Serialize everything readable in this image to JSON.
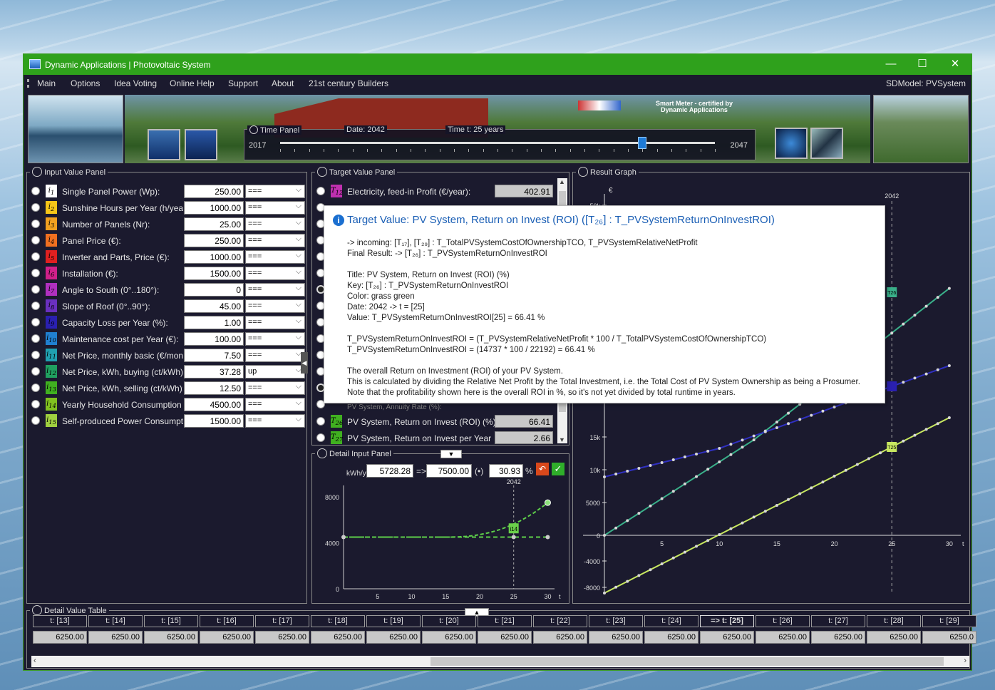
{
  "window": {
    "title": "Dynamic Applications | Photovoltaic System",
    "minimize": "—",
    "maximize": "☐",
    "close": "✕"
  },
  "menu": {
    "items": [
      "Main",
      "Options",
      "Idea Voting",
      "Online Help",
      "Support",
      "About",
      "21st century Builders"
    ],
    "model": "SDModel:  PVSystem"
  },
  "banner": {
    "cert_line1": "Smart Meter - certified by",
    "cert_line2": "Dynamic Applications"
  },
  "time_panel": {
    "label": "Time Panel",
    "date": "Date:  2042",
    "time": "Time t:  25  years",
    "start": "2017",
    "end": "2047",
    "slider_fraction": 0.833
  },
  "input_panel": {
    "title": "Input Value Panel",
    "rows": [
      {
        "sub": "1",
        "color": "#ffffff",
        "label": "Single Panel Power (Wp):",
        "value": "250.00",
        "mode": "==="
      },
      {
        "sub": "2",
        "color": "#f5c518",
        "label": "Sunshine Hours per Year (h/year):",
        "value": "1000.00",
        "mode": "==="
      },
      {
        "sub": "3",
        "color": "#f0a020",
        "label": "Number of Panels (Nr):",
        "value": "25.00",
        "mode": "==="
      },
      {
        "sub": "4",
        "color": "#f07020",
        "label": "Panel Price (€):",
        "value": "250.00",
        "mode": "==="
      },
      {
        "sub": "5",
        "color": "#e02020",
        "label": "Inverter and Parts, Price (€):",
        "value": "1000.00",
        "mode": "==="
      },
      {
        "sub": "6",
        "color": "#d0208a",
        "label": "Installation (€):",
        "value": "1500.00",
        "mode": "==="
      },
      {
        "sub": "7",
        "color": "#b030c0",
        "label": "Angle to South (0°..180°):",
        "value": "0",
        "mode": "==="
      },
      {
        "sub": "8",
        "color": "#6a30c0",
        "label": "Slope of Roof (0°..90°):",
        "value": "45.00",
        "mode": "==="
      },
      {
        "sub": "9",
        "color": "#2a20b0",
        "label": "Capacity Loss per Year (%):",
        "value": "1.00",
        "mode": "==="
      },
      {
        "sub": "10",
        "color": "#2080d0",
        "label": "Maintenance cost per Year (€):",
        "value": "100.00",
        "mode": "==="
      },
      {
        "sub": "11",
        "color": "#20a0b0",
        "label": "Net Price, monthly basic (€/month):",
        "value": "7.50",
        "mode": "==="
      },
      {
        "sub": "12",
        "color": "#20a060",
        "label": "Net Price, kWh, buying (ct/kWh):",
        "value": "37.28",
        "mode": "up"
      },
      {
        "sub": "13",
        "color": "#40b020",
        "label": "Net Price, kWh, selling (ct/kWh):",
        "value": "12.50",
        "mode": "==="
      },
      {
        "sub": "14",
        "color": "#80c020",
        "label": "Yearly Household Consumption (kW",
        "value": "4500.00",
        "mode": "==="
      },
      {
        "sub": "15",
        "color": "#a0d040",
        "label": "Self-produced Power Consumption (",
        "value": "1500.00",
        "mode": "==="
      }
    ]
  },
  "target_panel": {
    "title": "Target Value Panel",
    "top_row": {
      "sub": "12",
      "color": "#c030b0",
      "label": "Electricity, feed-in Profit (€/year):",
      "value": "402.91"
    },
    "partial_row": {
      "label": "PV System, Annuity Rate (%):"
    },
    "bottom_rows": [
      {
        "sub": "26",
        "color": "#40b020",
        "label": "PV System, Return on Invest (ROI) (%):",
        "value": "66.41"
      },
      {
        "sub": "27",
        "color": "#40b020",
        "label": "PV System, Return on Invest per Year (%/ye",
        "value": "2.66"
      }
    ]
  },
  "tooltip": {
    "heading": "Target Value:  PV System, Return on Invest (ROI)  ([T₂₆] : T_PVSystemReturnOnInvestROI)",
    "incoming": "-> incoming:   [T₁₇], [T₂₉] :  T_TotalPVSystemCostOfOwnershipTCO,  T_PVSystemRelativeNetProfit",
    "final_result": "Final Result:  -> [T₂₆] : T_PVSystemReturnOnInvestROI",
    "title_line": "Title:         PV System, Return on Invest (ROI) (%)",
    "key_line": "Key:           [T₂₆] : T_PVSystemReturnOnInvestROI",
    "color_line": "Color:         grass green",
    "date_line": "Date:          2042  ->  t = [25]",
    "value_line": "Value:         T_PVSystemReturnOnInvestROI[25] = 66.41 %",
    "formula1": "T_PVSystemReturnOnInvestROI  =  (T_PVSystemRelativeNetProfit * 100 / T_TotalPVSystemCostOfOwnershipTCO)",
    "formula2": "T_PVSystemReturnOnInvestROI  =  (14737 * 100 / 22192)  =  66.41  %",
    "desc1": "The overall Return on Investment (ROI) of your PV System.",
    "desc2": "This is calculated by dividing the Relative Net Profit by the Total Investment, i.e. the Total Cost of PV System Ownership as being a Prosumer.",
    "desc3": "Note that the profitability shown here is the overall ROI in %, so it's not yet divided by total runtime in years."
  },
  "detail_input": {
    "title": "Detail Input Panel",
    "unit": "kWh/y",
    "from_value": "5728.28",
    "arrow": "=>",
    "to_value": "7500.00",
    "radio": "(•)",
    "percent": "30.93",
    "percent_sign": "%",
    "marker_year": "2042",
    "marker_label": "i14",
    "yticks": [
      "8000",
      "4000",
      "0"
    ],
    "xticks": [
      "5",
      "10",
      "15",
      "20",
      "25",
      "30",
      "t"
    ]
  },
  "result_graph": {
    "title": "Result Graph",
    "y_unit": "€",
    "marker_year": "2042",
    "yticks": [
      "50k",
      "15k",
      "10k",
      "5000",
      "0",
      "-4000",
      "-8000"
    ],
    "xticks": [
      "5",
      "10",
      "15",
      "20",
      "25",
      "30",
      "t"
    ],
    "marker_labels": [
      "T26",
      "T25"
    ]
  },
  "detail_table": {
    "title": "Detail Value Table",
    "columns": [
      "t: [13]",
      "t: [14]",
      "t: [15]",
      "t: [16]",
      "t: [17]",
      "t: [18]",
      "t: [19]",
      "t: [20]",
      "t: [21]",
      "t: [22]",
      "t: [23]",
      "t: [24]",
      "=> t: [25]",
      "t: [26]",
      "t: [27]",
      "t: [28]",
      "t: [29]"
    ],
    "values": [
      "6250.00",
      "6250.00",
      "6250.00",
      "6250.00",
      "6250.00",
      "6250.00",
      "6250.00",
      "6250.00",
      "6250.00",
      "6250.00",
      "6250.00",
      "6250.00",
      "6250.00",
      "6250.00",
      "6250.00",
      "6250.00",
      "6250.0"
    ]
  },
  "colors": {
    "titlebar": "#2fa11c",
    "panel_bg": "#1b1a2e",
    "accent": "#1b6fd0"
  }
}
